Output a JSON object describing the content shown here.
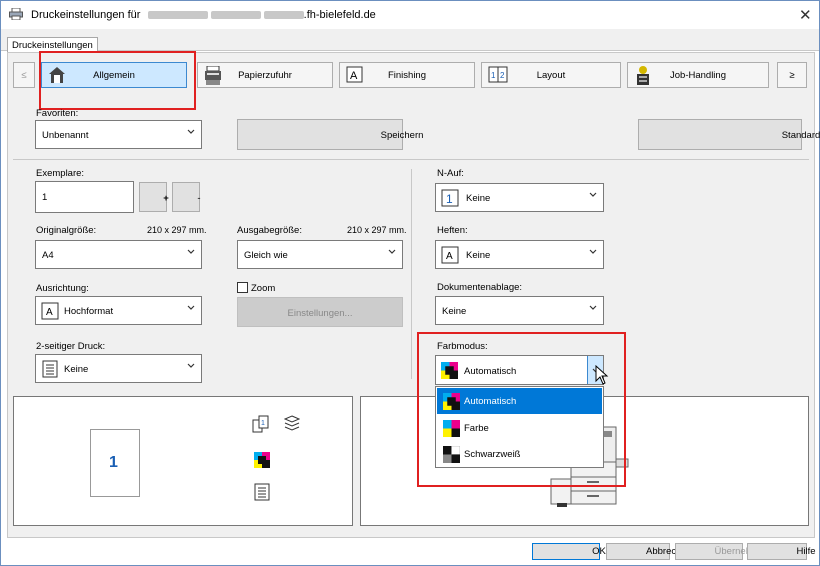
{
  "window": {
    "title_prefix": "Druckeinstellungen für",
    "title_suffix": ".fh-bielefeld.de",
    "close_glyph": "✕"
  },
  "tabs": [
    "Druckeinstellungen"
  ],
  "nav": {
    "prev": "≤",
    "next": "≥",
    "items": [
      {
        "label": "Allgemein",
        "icon": "house-icon"
      },
      {
        "label": "Papierzufuhr",
        "icon": "printer-tray-icon"
      },
      {
        "label": "Finishing",
        "icon": "finishing-icon"
      },
      {
        "label": "Layout",
        "icon": "layout-icon"
      },
      {
        "label": "Job-Handling",
        "icon": "job-handling-icon"
      }
    ]
  },
  "favorites": {
    "label": "Favoriten:",
    "value": "Unbenannt",
    "save_button": "Speichern",
    "standard_button": "Standard"
  },
  "left": {
    "copies_label": "Exemplare:",
    "copies_value": "1",
    "plus": "+",
    "minus": "-",
    "original_label": "Originalgröße:",
    "original_dims": "210 x 297 mm.",
    "original_value": "A4",
    "output_label": "Ausgabegröße:",
    "output_dims": "210 x 297 mm.",
    "output_value": "Gleich wie",
    "orientation_label": "Ausrichtung:",
    "orientation_value": "Hochformat",
    "zoom_label": "Zoom",
    "settings_button": "Einstellungen...",
    "duplex_label": "2-seitiger Druck:",
    "duplex_value": "Keine"
  },
  "right": {
    "nup_label": "N-Auf:",
    "nup_value": "Keine",
    "staple_label": "Heften:",
    "staple_value": "Keine",
    "docstore_label": "Dokumentenablage:",
    "docstore_value": "Keine",
    "color_label": "Farbmodus:",
    "color_value": "Automatisch",
    "color_options": [
      "Automatisch",
      "Farbe",
      "Schwarzweiß"
    ]
  },
  "preview": {
    "page_number": "1"
  },
  "footer": {
    "ok": "OK",
    "cancel": "Abbrechen",
    "apply": "Übernehmen",
    "help": "Hilfe"
  },
  "colors": {
    "accent": "#0078d7",
    "selected_tab": "#cde8ff",
    "highlight_red": "#e02020"
  }
}
